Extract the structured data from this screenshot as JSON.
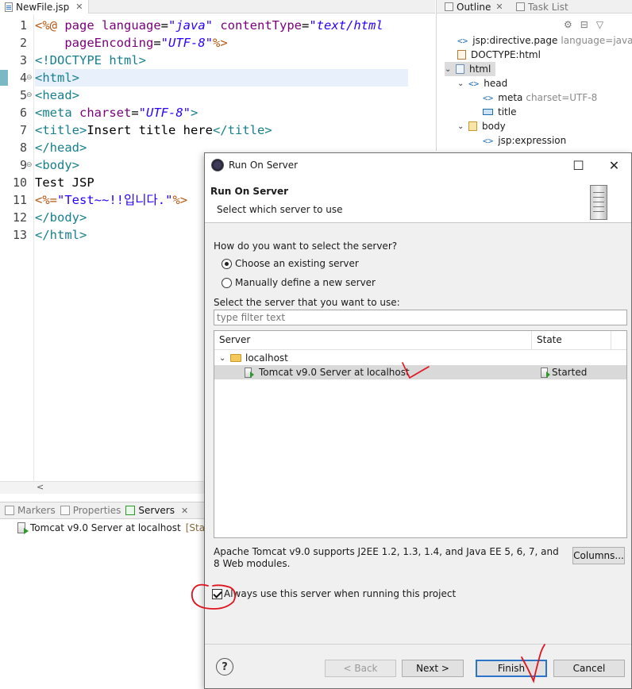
{
  "editor": {
    "tab_label": "NewFile.jsp",
    "line_numbers": [
      "1",
      "2",
      "3",
      "4",
      "5",
      "6",
      "7",
      "8",
      "9",
      "10",
      "11",
      "12",
      "13"
    ],
    "code_lines": [
      [
        [
          "jsp",
          "<%@ "
        ],
        [
          "attr",
          "page "
        ],
        [
          "attr",
          "language"
        ],
        [
          "plain",
          "="
        ],
        [
          "str",
          "\"java\""
        ],
        [
          "plain",
          " "
        ],
        [
          "attr",
          "contentType"
        ],
        [
          "plain",
          "="
        ],
        [
          "str",
          "\"text/html"
        ]
      ],
      [
        [
          "plain",
          "    "
        ],
        [
          "attr",
          "pageEncoding"
        ],
        [
          "plain",
          "="
        ],
        [
          "str",
          "\"UTF-8\""
        ],
        [
          "jsp",
          "%>"
        ]
      ],
      [
        [
          "tag",
          "<!DOCTYPE "
        ],
        [
          "tag",
          "html"
        ],
        [
          "tag",
          ">"
        ]
      ],
      [
        [
          "tag",
          "<html>"
        ]
      ],
      [
        [
          "tag",
          "<head>"
        ]
      ],
      [
        [
          "tag",
          "<meta "
        ],
        [
          "attr",
          "charset"
        ],
        [
          "plain",
          "="
        ],
        [
          "str",
          "\"UTF-8\""
        ],
        [
          "tag",
          ">"
        ]
      ],
      [
        [
          "tag",
          "<title>"
        ],
        [
          "plain",
          "Insert title here"
        ],
        [
          "tag",
          "</title>"
        ]
      ],
      [
        [
          "tag",
          "</head>"
        ]
      ],
      [
        [
          "tag",
          "<body>"
        ]
      ],
      [
        [
          "plain",
          "Test JSP"
        ]
      ],
      [
        [
          "jsp",
          "<%="
        ],
        [
          "jspstr",
          "\"Test~~!!입니다.\""
        ],
        [
          "jsp",
          "%>"
        ]
      ],
      [
        [
          "tag",
          "</body>"
        ]
      ],
      [
        [
          "tag",
          "</html>"
        ]
      ]
    ],
    "hscroll_arrow": "<"
  },
  "outline": {
    "tabs": [
      {
        "label": "Outline"
      },
      {
        "label": "Task List"
      }
    ],
    "tree": [
      {
        "label": "jsp:directive.page",
        "meta": "language=java"
      },
      {
        "label": "DOCTYPE:html",
        "meta": ""
      },
      {
        "label": "html",
        "meta": ""
      },
      {
        "label": "head",
        "meta": ""
      },
      {
        "label": "meta",
        "meta": "charset=UTF-8"
      },
      {
        "label": "title",
        "meta": ""
      },
      {
        "label": "body",
        "meta": ""
      },
      {
        "label": "jsp:expression",
        "meta": ""
      }
    ]
  },
  "bottom": {
    "tabs": [
      {
        "label": "Markers"
      },
      {
        "label": "Properties"
      },
      {
        "label": "Servers"
      }
    ],
    "server_row": {
      "name": "Tomcat v9.0 Server at localhost",
      "status": "[Starte"
    }
  },
  "dialog": {
    "window_title": "Run On Server",
    "header_title": "Run On Server",
    "header_subtitle": "Select which server to use",
    "question": "How do you want to select the server?",
    "radio_existing": "Choose an existing server",
    "radio_manual": "Manually define a new server",
    "select_label": "Select the server that you want to use:",
    "filter_placeholder": "type filter text",
    "col_server": "Server",
    "col_state": "State",
    "group": "localhost",
    "server_name": "Tomcat v9.0 Server at localhost",
    "server_state": "Started",
    "description": "Apache Tomcat v9.0 supports J2EE 1.2, 1.3, 1.4, and Java EE 5, 6, 7, and 8 Web modules.",
    "columns_button": "Columns...",
    "always_use": "Always use this server when running this project",
    "back_button": "< Back",
    "next_button": "Next >",
    "finish_button": "Finish",
    "cancel_button": "Cancel",
    "help_icon_char": "?"
  },
  "colors": {
    "annotation_red": "#e0141e",
    "default_button_border": "#2b74c7"
  }
}
